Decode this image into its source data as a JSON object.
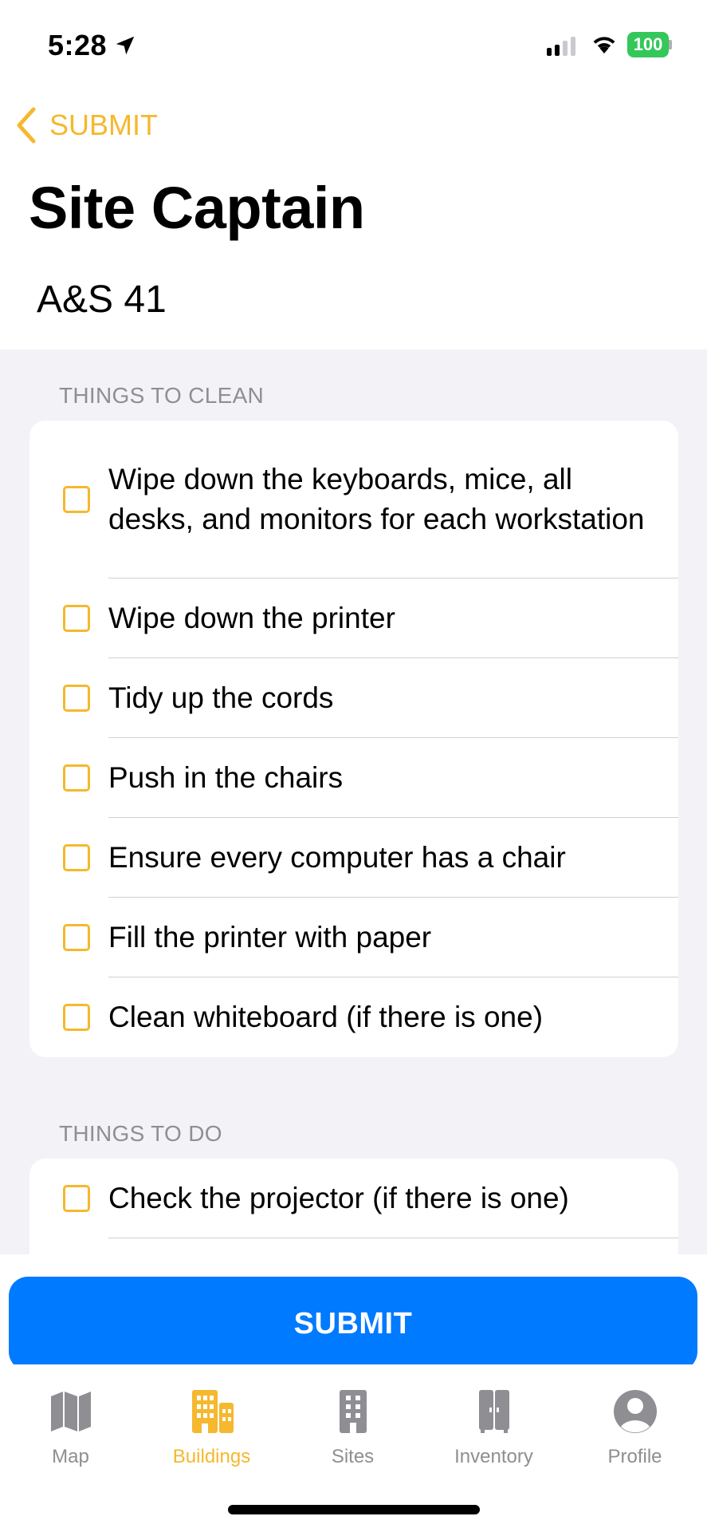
{
  "status_bar": {
    "time": "5:28",
    "battery": "100"
  },
  "nav": {
    "back_label": "SUBMIT"
  },
  "page": {
    "title": "Site Captain",
    "room": "A&S 41"
  },
  "sections": [
    {
      "header": "THINGS TO CLEAN",
      "items": [
        "Wipe down the keyboards, mice, all desks, and monitors for each workstation",
        "Wipe down the printer",
        "Tidy up the cords",
        "Push in the chairs",
        "Ensure every computer has a chair",
        "Fill the printer with paper",
        "Clean whiteboard (if there is one)"
      ]
    },
    {
      "header": "THINGS TO DO",
      "items": [
        "Check the projector (if there is one)"
      ]
    }
  ],
  "submit_label": "SUBMIT",
  "tabs": [
    {
      "label": "Map",
      "icon": "map-icon",
      "active": false
    },
    {
      "label": "Buildings",
      "icon": "buildings-icon",
      "active": true
    },
    {
      "label": "Sites",
      "icon": "sites-icon",
      "active": false
    },
    {
      "label": "Inventory",
      "icon": "inventory-icon",
      "active": false
    },
    {
      "label": "Profile",
      "icon": "profile-icon",
      "active": false
    }
  ],
  "colors": {
    "accent": "#f5b82e",
    "primary": "#007aff",
    "inactive": "#8e8e93",
    "background": "#f2f2f7"
  }
}
